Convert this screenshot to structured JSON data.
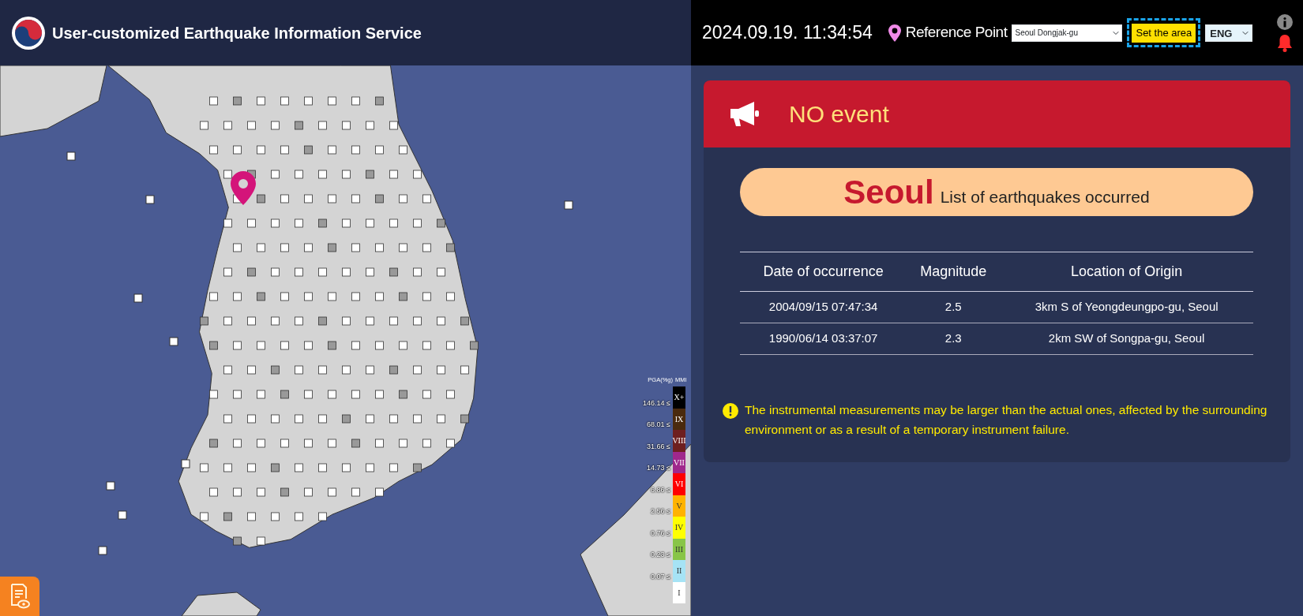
{
  "header": {
    "title": "User-customized Earthquake Information Service",
    "datetime": "2024.09.19. 11:34:54",
    "reference_label": "Reference Point",
    "reference_select": {
      "value": "Seoul Dongjak-gu"
    },
    "set_area_button": "Set the area",
    "language_select": {
      "value": "ENG"
    }
  },
  "map": {
    "legend": {
      "pga_heading": "PGA(%g)",
      "mmi_heading": "MMI",
      "items": [
        {
          "pga": "146.14 ≤",
          "mmi": "X+",
          "color": "#000000"
        },
        {
          "pga": "68.01 ≤",
          "mmi": "IX",
          "color": "#4a2a0e"
        },
        {
          "pga": "31.66 ≤",
          "mmi": "VIII",
          "color": "#6e1f1f"
        },
        {
          "pga": "14.73 ≤",
          "mmi": "VII",
          "color": "#a0288c"
        },
        {
          "pga": "6.86 ≤",
          "mmi": "VI",
          "color": "#ff0000"
        },
        {
          "pga": "2.56 ≤",
          "mmi": "V",
          "color": "#ffb300"
        },
        {
          "pga": "0.76 ≤",
          "mmi": "IV",
          "color": "#ffff00"
        },
        {
          "pga": "0.23 ≤",
          "mmi": "III",
          "color": "#88c548"
        },
        {
          "pga": "0.07 ≤",
          "mmi": "II",
          "color": "#a6e3f5"
        },
        {
          "mmi": "I",
          "color": "#ffffff"
        }
      ]
    }
  },
  "event_card": {
    "status": "NO event",
    "region": "Seoul",
    "list_title": "List of earthquakes occurred",
    "table": {
      "columns": [
        "Date of occurrence",
        "Magnitude",
        "Location of Origin"
      ],
      "rows": [
        [
          "2004/09/15 07:47:34",
          "2.5",
          "3km S of Yeongdeungpo-gu, Seoul"
        ],
        [
          "1990/06/14 03:37:07",
          "2.3",
          "2km SW of Songpa-gu, Seoul"
        ]
      ]
    },
    "notice": "The instrumental measurements may be larger than the actual ones, affected by the surrounding environment or as a result of a temporary instrument failure."
  }
}
